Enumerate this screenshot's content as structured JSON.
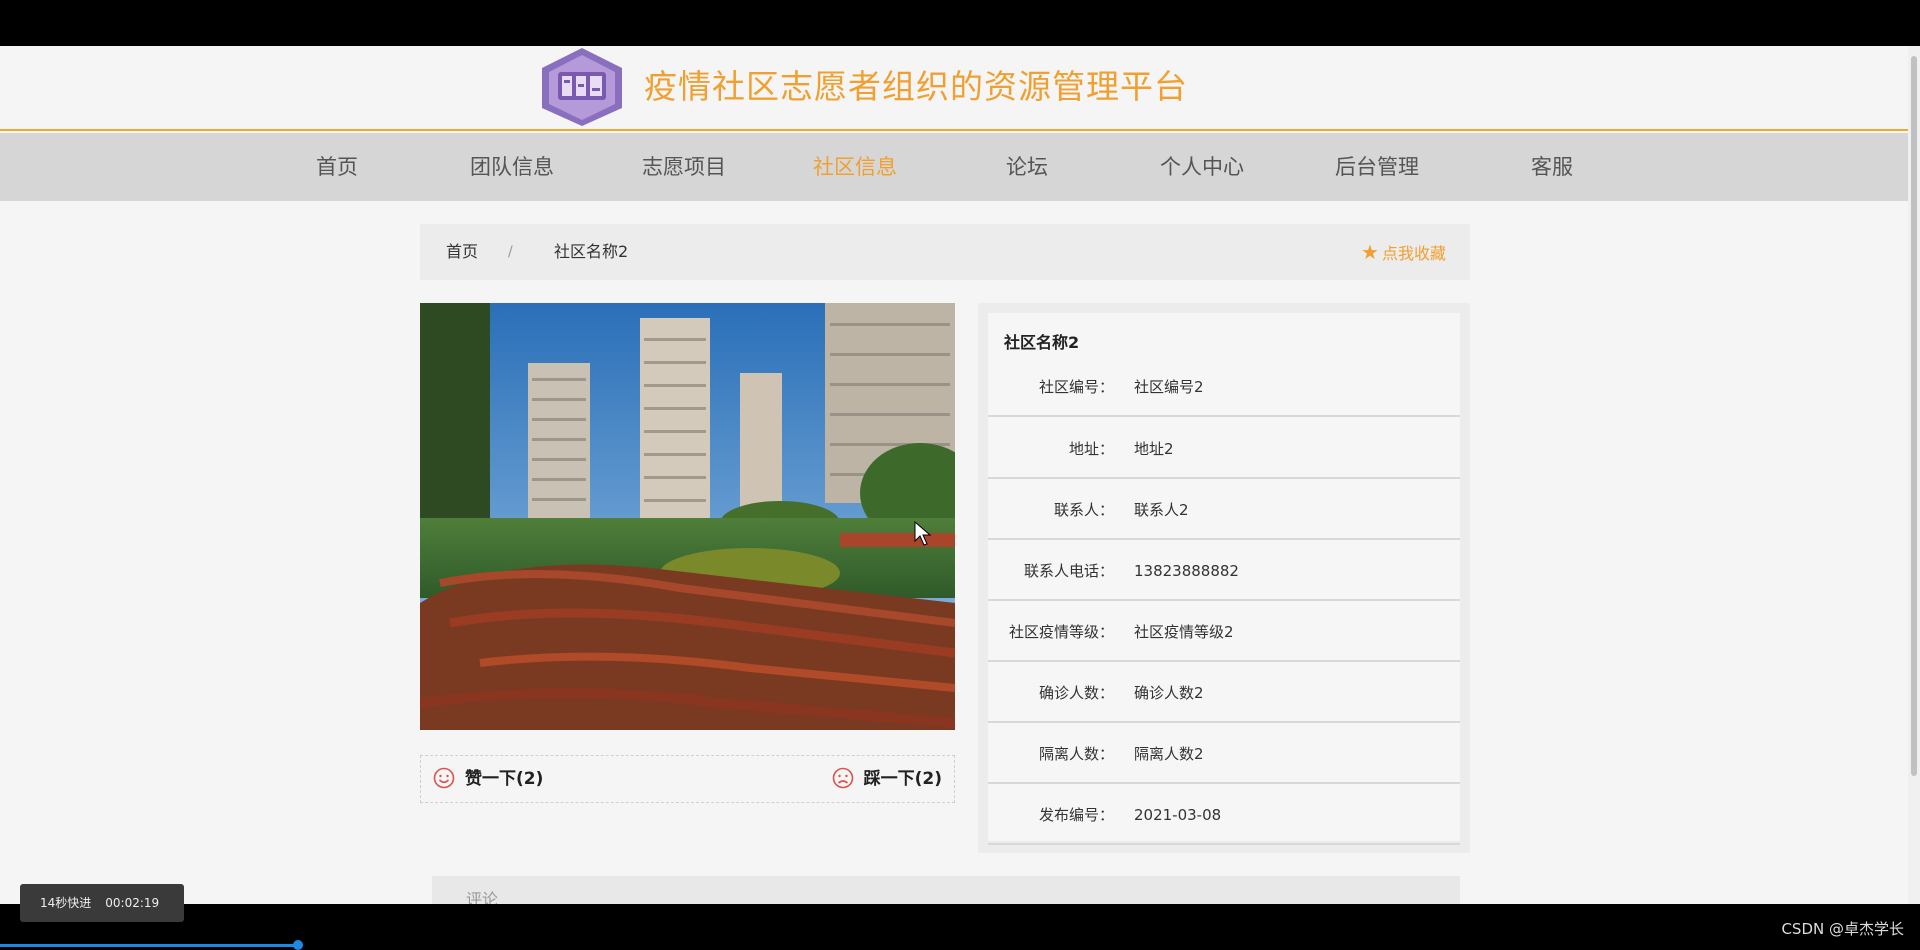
{
  "header": {
    "site_title": "疫情社区志愿者组织的资源管理平台",
    "logo_icon": "hexagon-logo-icon",
    "logo_color": "#8a6fbf",
    "accent_color": "#f0a030"
  },
  "nav": {
    "items": [
      {
        "label": "首页",
        "active": false
      },
      {
        "label": "团队信息",
        "active": false
      },
      {
        "label": "志愿项目",
        "active": false
      },
      {
        "label": "社区信息",
        "active": true
      },
      {
        "label": "论坛",
        "active": false
      },
      {
        "label": "个人中心",
        "active": false
      },
      {
        "label": "后台管理",
        "active": false
      },
      {
        "label": "客服",
        "active": false
      }
    ]
  },
  "breadcrumb": {
    "home": "首页",
    "separator": "/",
    "current": "社区名称2",
    "favorite": "点我收藏",
    "favorite_icon": "star-icon"
  },
  "reactions": {
    "like": "赞一下(2)",
    "dislike": "踩一下(2)",
    "like_icon": "smile-icon",
    "dislike_icon": "frown-icon"
  },
  "detail": {
    "title": "社区名称2",
    "rows": [
      {
        "label": "社区编号：",
        "value": "社区编号2"
      },
      {
        "label": "地址：",
        "value": "地址2"
      },
      {
        "label": "联系人：",
        "value": "联系人2"
      },
      {
        "label": "联系人电话：",
        "value": "13823888882"
      },
      {
        "label": "社区疫情等级：",
        "value": "社区疫情等级2"
      },
      {
        "label": "确诊人数：",
        "value": "确诊人数2"
      },
      {
        "label": "隔离人数：",
        "value": "隔离人数2"
      },
      {
        "label": "发布编号：",
        "value": "2021-03-08"
      }
    ]
  },
  "comments": {
    "label": "评论"
  },
  "video_overlay": {
    "speed": "14秒快进",
    "time": "00:02:19",
    "watermark": "CSDN @卓杰学长"
  }
}
